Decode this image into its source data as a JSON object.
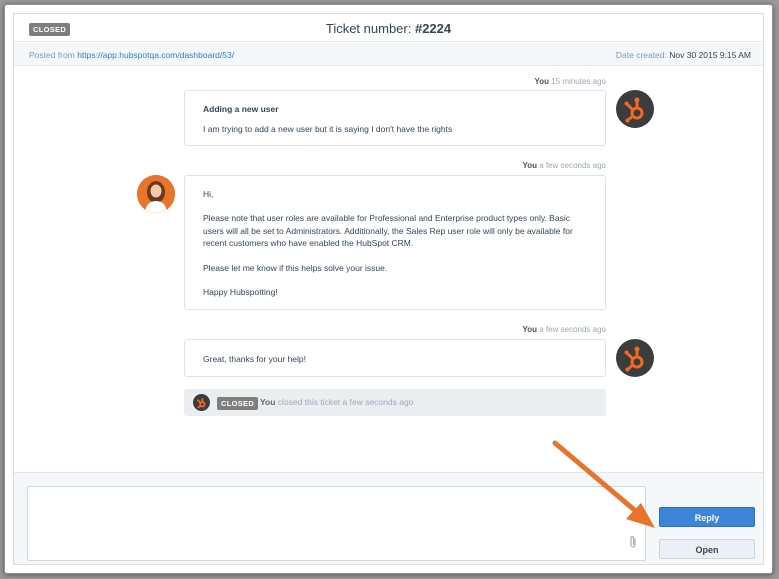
{
  "header": {
    "status_badge": "CLOSED",
    "title_prefix": "Ticket number: ",
    "ticket_number": "#2224"
  },
  "meta": {
    "posted_from_label": "Posted from ",
    "posted_from_url": "https://app.hubspotqa.com/dashboard/53/",
    "date_created_label": "Date created: ",
    "date_created_value": "Nov 30 2015 9:15 AM"
  },
  "messages": [
    {
      "author": "You",
      "time": " 15 minutes ago",
      "subject": "Adding a new user",
      "body": "I am trying to add a new user but it is saying I don't have the rights"
    },
    {
      "author": "You",
      "time": " a few seconds ago",
      "p1": "Hi,",
      "p2": "Please note that user roles are available for Professional and Enterprise product types only. Basic users will all be set to Administrators. Additionally, the Sales Rep user role will only be available for recent customers who have enabled the HubSpot CRM.",
      "p3": "Please let me know if this helps solve your issue.",
      "p4": "Happy Hubspotting!"
    },
    {
      "author": "You",
      "time": " a few seconds ago",
      "body": "Great, thanks for your help!"
    }
  ],
  "closed_event": {
    "badge": "CLOSED",
    "actor": "You",
    "text": " closed this ticket a few seconds ago"
  },
  "composer": {
    "reply_label": "Reply",
    "open_label": "Open"
  },
  "colors": {
    "hubspot_orange": "#f26a1f",
    "reply_blue": "#3d85d8",
    "arrow_orange": "#e8742c"
  },
  "icons": {
    "hubspot_avatar": "hubspot-sprocket-icon",
    "attachment": "paperclip-icon"
  }
}
